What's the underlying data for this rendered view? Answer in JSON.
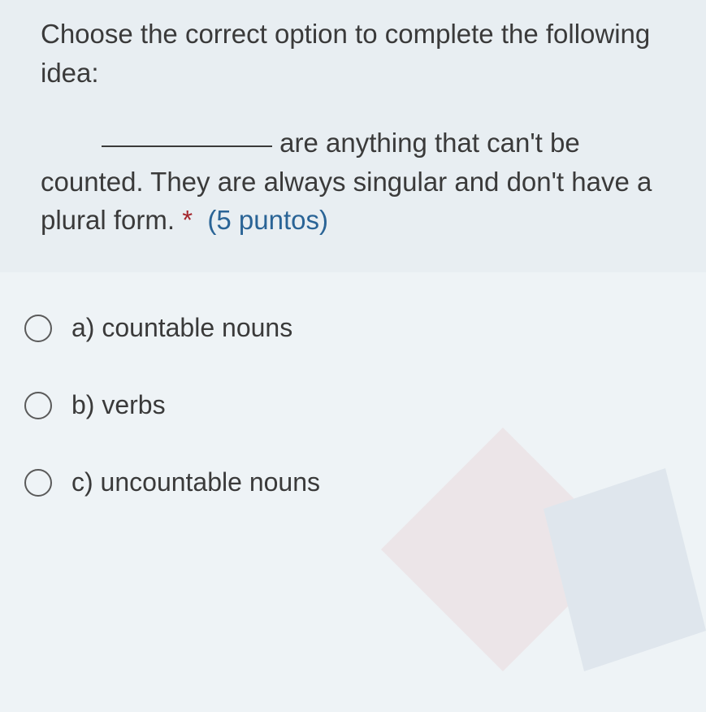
{
  "question": {
    "intro": "Choose the correct option to complete the following idea:",
    "sentence_after_blank": " are anything that can't be counted. They are always singular and don't have a plural form.",
    "required_mark": "*",
    "points_label": "(5 puntos)"
  },
  "options": [
    {
      "label": "a) countable nouns"
    },
    {
      "label": "b) verbs"
    },
    {
      "label": "c) uncountable nouns"
    }
  ]
}
